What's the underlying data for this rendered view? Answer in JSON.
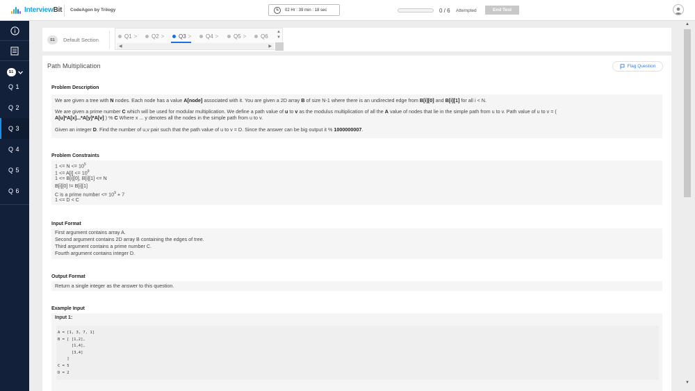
{
  "header": {
    "logo_left": "Interview",
    "logo_right": "Bit",
    "brand": "CodeAgon by Trilogy",
    "timer": "02 Hr : 39 min : 18 sec",
    "progress_fraction": 0,
    "attempted_count": "0 / 6",
    "attempted_label": "Attempted",
    "end_test_label": "End Test"
  },
  "sidebar": {
    "section_badge": "S1",
    "questions": [
      {
        "label": "Q 1"
      },
      {
        "label": "Q 2"
      },
      {
        "label": "Q 3",
        "active": true
      },
      {
        "label": "Q 4"
      },
      {
        "label": "Q 5"
      },
      {
        "label": "Q 6"
      }
    ]
  },
  "section": {
    "badge": "S1",
    "name": "Default Section",
    "tabs": [
      {
        "label": "Q1"
      },
      {
        "label": "Q2"
      },
      {
        "label": "Q3",
        "current": true
      },
      {
        "label": "Q4"
      },
      {
        "label": "Q5"
      },
      {
        "label": "Q6"
      }
    ]
  },
  "question": {
    "title": "Path Multiplication",
    "flag_label": "Flag Question",
    "description_heading": "Problem Description",
    "constraints_heading": "Problem Constraints",
    "constraints": [
      {
        "pre": "1 <= N <= 10",
        "sup": "5",
        "post": ""
      },
      {
        "pre": "1 <= A[i] <= 10",
        "sup": "9",
        "post": ""
      },
      {
        "pre": "1 <= B[i][0], B[i][1] <= N",
        "sup": "",
        "post": ""
      },
      {
        "pre": "B[i][0] != B[i][1]",
        "sup": "",
        "post": ""
      },
      {
        "pre": "C is a prime number <= 10",
        "sup": "9",
        "post": " + 7"
      },
      {
        "pre": "1 <= D < C",
        "sup": "",
        "post": ""
      }
    ],
    "input_heading": "Input Format",
    "input_lines": [
      "First argument contains array A.",
      "Second argument contains 2D array B containing the edges of tree.",
      "Third argument contains a prime number C.",
      "Fourth argument contains integer D."
    ],
    "output_heading": "Output Format",
    "output_text": "Return a single integer as the answer to this question.",
    "example_heading": "Example Input",
    "example_label": "Input 1:",
    "example_code": "A = [1, 3, 7, 1]\nB = [ [1,2],\n      [1,4],\n      [3,4]\n    ]\nC = 5\nD = 2"
  },
  "colors": {
    "sidebar_bg": "#13203a",
    "accent": "#1b6fe0",
    "flag_text": "#3a7bd5"
  }
}
